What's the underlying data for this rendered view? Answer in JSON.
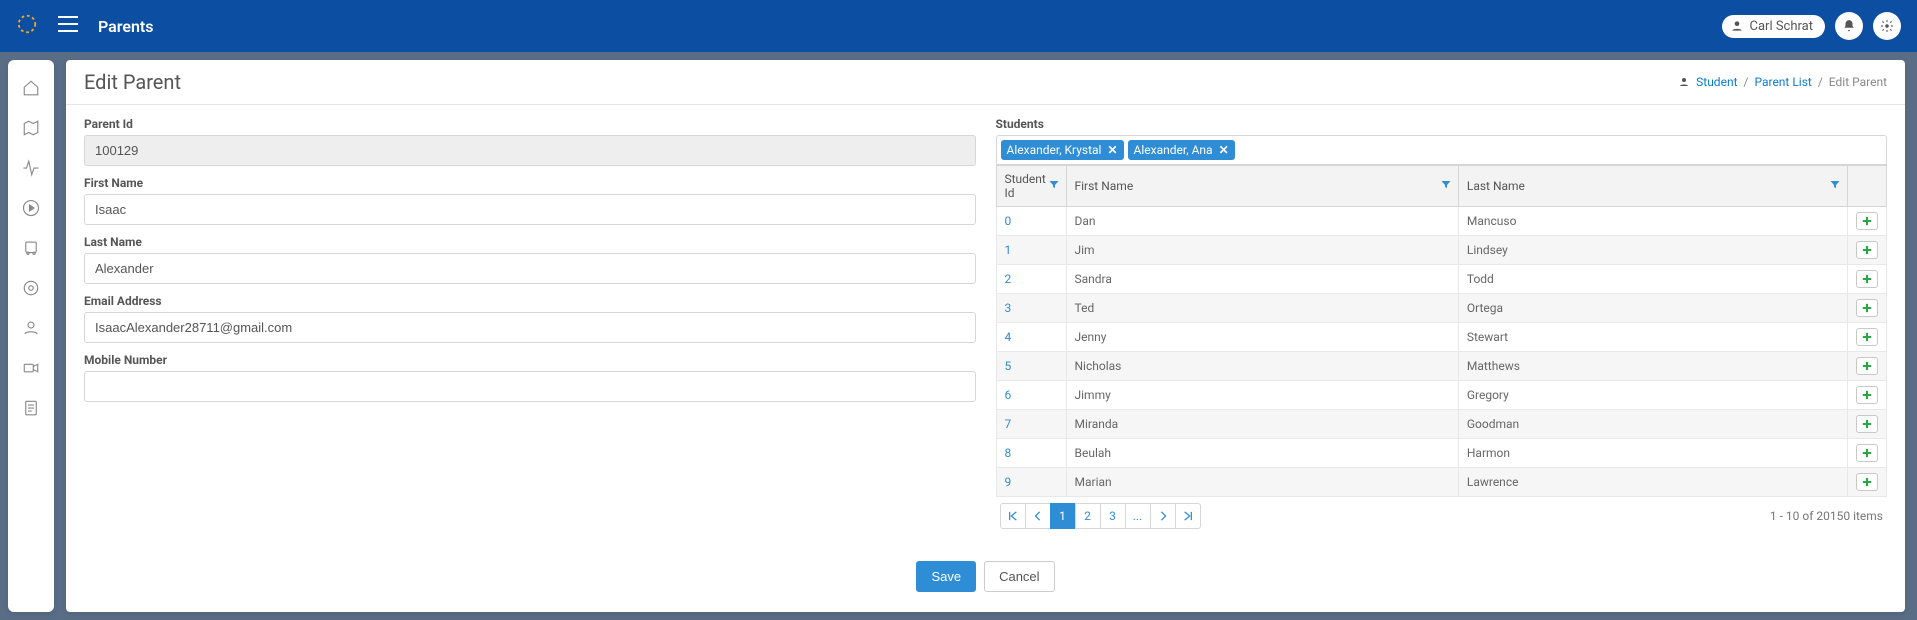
{
  "topbar": {
    "title": "Parents",
    "user_name": "Carl Schrat"
  },
  "breadcrumb": {
    "root": "Student",
    "mid": "Parent List",
    "leaf": "Edit Parent"
  },
  "page": {
    "heading": "Edit Parent"
  },
  "form": {
    "parent_id_label": "Parent Id",
    "parent_id_value": "100129",
    "first_name_label": "First Name",
    "first_name_value": "Isaac",
    "last_name_label": "Last Name",
    "last_name_value": "Alexander",
    "email_label": "Email Address",
    "email_value": "IsaacAlexander28711@gmail.com",
    "mobile_label": "Mobile Number",
    "mobile_value": ""
  },
  "students": {
    "label": "Students",
    "tags": [
      "Alexander, Krystal",
      "Alexander, Ana"
    ],
    "columns": {
      "id": "Student Id",
      "first": "First Name",
      "last": "Last Name"
    },
    "rows": [
      {
        "id": "0",
        "first": "Dan",
        "last": "Mancuso"
      },
      {
        "id": "1",
        "first": "Jim",
        "last": "Lindsey"
      },
      {
        "id": "2",
        "first": "Sandra",
        "last": "Todd"
      },
      {
        "id": "3",
        "first": "Ted",
        "last": "Ortega"
      },
      {
        "id": "4",
        "first": "Jenny",
        "last": "Stewart"
      },
      {
        "id": "5",
        "first": "Nicholas",
        "last": "Matthews"
      },
      {
        "id": "6",
        "first": "Jimmy",
        "last": "Gregory"
      },
      {
        "id": "7",
        "first": "Miranda",
        "last": "Goodman"
      },
      {
        "id": "8",
        "first": "Beulah",
        "last": "Harmon"
      },
      {
        "id": "9",
        "first": "Marian",
        "last": "Lawrence"
      }
    ],
    "pagination": {
      "pages": [
        "1",
        "2",
        "3",
        "..."
      ],
      "active": "1",
      "info": "1 - 10 of 20150 items"
    }
  },
  "actions": {
    "save": "Save",
    "cancel": "Cancel"
  }
}
